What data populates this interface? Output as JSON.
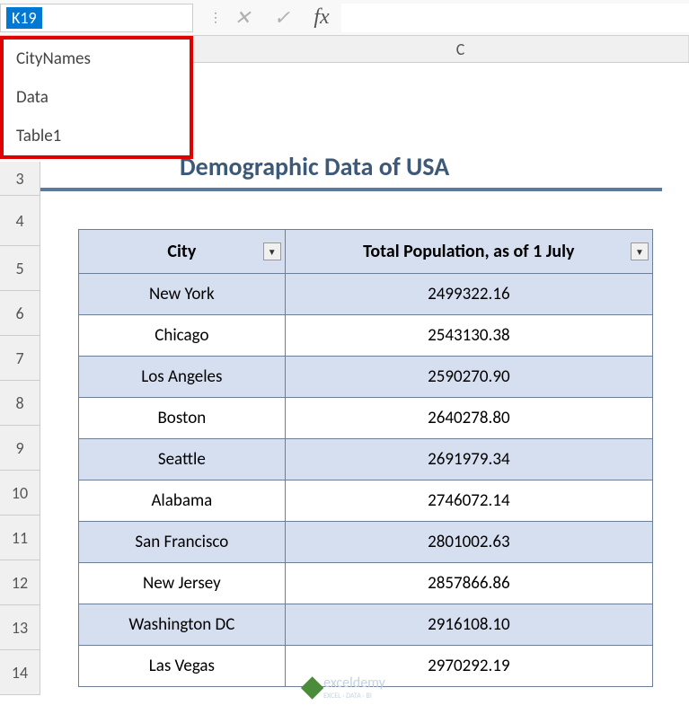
{
  "nameBox": {
    "value": "K19",
    "dropdownItems": [
      "CityNames",
      "Data",
      "Table1"
    ]
  },
  "formulaBar": {
    "cancelIcon": "✕",
    "confirmIcon": "✓",
    "fxLabel": "fx",
    "value": ""
  },
  "columnHeaders": {
    "c": "C"
  },
  "rowHeaders": [
    "3",
    "4",
    "5",
    "6",
    "7",
    "8",
    "9",
    "10",
    "11",
    "12",
    "13",
    "14"
  ],
  "title": "Demographic Data of USA",
  "table": {
    "headers": {
      "city": "City",
      "population": "Total Population, as of 1 July"
    },
    "rows": [
      {
        "city": "New York",
        "pop": "2499322.16"
      },
      {
        "city": "Chicago",
        "pop": "2543130.38"
      },
      {
        "city": "Los Angeles",
        "pop": "2590270.90"
      },
      {
        "city": "Boston",
        "pop": "2640278.80"
      },
      {
        "city": "Seattle",
        "pop": "2691979.34"
      },
      {
        "city": "Alabama",
        "pop": "2746072.14"
      },
      {
        "city": "San Francisco",
        "pop": "2801002.63"
      },
      {
        "city": "New Jersey",
        "pop": "2857866.86"
      },
      {
        "city": "Washington DC",
        "pop": "2916108.10"
      },
      {
        "city": "Las Vegas",
        "pop": "2970292.19"
      }
    ]
  },
  "watermark": {
    "name": "exceldemy",
    "tagline": "EXCEL · DATA · BI"
  }
}
